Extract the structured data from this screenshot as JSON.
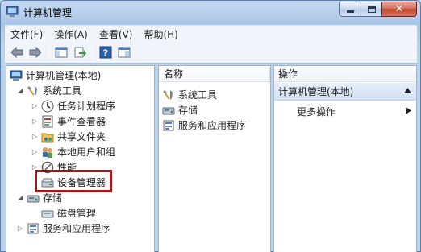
{
  "window": {
    "title": "计算机管理"
  },
  "menu": {
    "items": [
      "文件(F)",
      "操作(A)",
      "查看(V)",
      "帮助(H)"
    ]
  },
  "tree": {
    "root": "计算机管理(本地)",
    "system_tools": "系统工具",
    "task_scheduler": "任务计划程序",
    "event_viewer": "事件查看器",
    "shared_folders": "共享文件夹",
    "local_users": "本地用户和组",
    "performance": "性能",
    "device_manager": "设备管理器",
    "storage": "存储",
    "disk_management": "磁盘管理",
    "services_apps": "服务和应用程序"
  },
  "list": {
    "header": "名称",
    "items": [
      "系统工具",
      "存储",
      "服务和应用程序"
    ]
  },
  "actions": {
    "header": "操作",
    "section": "计算机管理(本地)",
    "more": "更多操作"
  },
  "colors": {
    "highlight_box": "#a01a1c",
    "frame": "#b9d1ea"
  }
}
